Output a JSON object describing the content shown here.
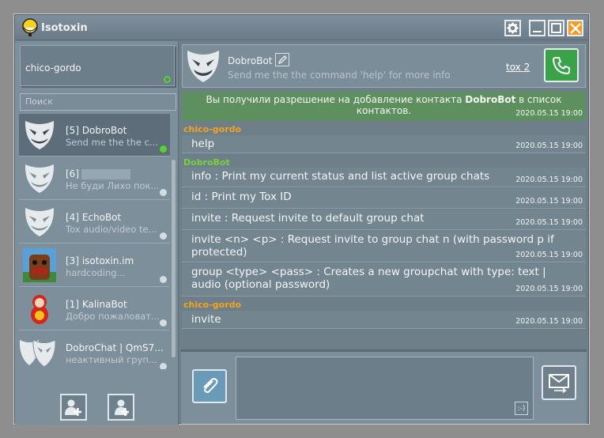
{
  "window": {
    "title": "Isotoxin",
    "accent_close": "#f59a23"
  },
  "profile": {
    "name": "chico-gordo",
    "online_color": "#54d42c"
  },
  "search": {
    "placeholder": "Поиск"
  },
  "contacts": [
    {
      "name": "[5] DobroBot",
      "status": "Send me the the c...",
      "avatar": "ghost-mask-icon",
      "presence": "online",
      "active": true
    },
    {
      "name": "[6]",
      "status": "Не буди Лихо пок...",
      "avatar": "ghost-mask-icon",
      "presence": "offline",
      "active": false
    },
    {
      "name": "[4] EchoBot",
      "status": "Tox audio/video te...",
      "avatar": "ghost-mask-icon",
      "presence": "offline",
      "active": false
    },
    {
      "name": "[3] isotoxin.im",
      "status": "hardcoding...",
      "avatar": "domo-photo",
      "presence": "offline",
      "active": false
    },
    {
      "name": "[1] KalinaBot",
      "status": "Добро пожаловат...",
      "avatar": "matryoshka-photo",
      "presence": "offline",
      "active": false
    },
    {
      "name": "DobroChat | QmS7...",
      "status": "неактивный груп...",
      "avatar": "group-ghost-mask-icon",
      "presence": "offline",
      "active": false
    }
  ],
  "chat": {
    "contact_name": "DobroBot",
    "contact_status": "Send me the the command 'help' for more info",
    "tox_label": "tox 2",
    "notice_text_pre": "Вы получили разрешение на добавление контакта ",
    "notice_contact": "DobroBot",
    "notice_text_post": " в список контактов.",
    "notice_time": "2020.05.15 19:00",
    "self_color": "#f4a418",
    "bot_color": "#76d23a",
    "groups": [
      {
        "author": "chico-gordo",
        "messages": [
          {
            "text": "help",
            "time": "2020.05.15 19:00"
          }
        ]
      },
      {
        "author": "DobroBot",
        "messages": [
          {
            "text": "info : Print my current status and list active group chats",
            "time": "2020.05.15 19:00"
          },
          {
            "text": "id : Print my Tox ID",
            "time": "2020.05.15 19:00"
          },
          {
            "text": "invite : Request invite to default group chat",
            "time": "2020.05.15 19:00"
          },
          {
            "text": "invite <n> <p> : Request invite to group chat n (with password p if protected)",
            "time": "2020.05.15 19:00"
          },
          {
            "text": "group <type> <pass> : Creates a new groupchat with type: text | audio (optional password)",
            "time": "2020.05.15 19:00"
          }
        ]
      },
      {
        "author": "chico-gordo",
        "messages": [
          {
            "text": "invite",
            "time": "2020.05.15 19:00"
          }
        ]
      }
    ]
  },
  "composer": {
    "emoji_label": ":-)"
  }
}
